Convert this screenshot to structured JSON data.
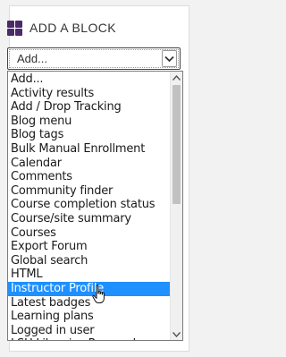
{
  "block": {
    "title": "ADD A BLOCK",
    "select_value": "Add..."
  },
  "icons": {
    "blocks": "blocks-grid-icon",
    "dropdown": "chevron-down-icon",
    "scroll_up": "scroll-up-arrow-icon",
    "scroll_down": "scroll-down-arrow-icon",
    "cursor": "hand-pointer-icon"
  },
  "colors": {
    "icon": "#4a2a6a",
    "selected": "#1e90ff"
  },
  "options": [
    "Add...",
    "Activity results",
    "Add / Drop Tracking",
    "Blog menu",
    "Blog tags",
    "Bulk Manual Enrollment",
    "Calendar",
    "Comments",
    "Community finder",
    "Course completion status",
    "Course/site summary",
    "Courses",
    "Export Forum",
    "Global search",
    "HTML",
    "Instructor Profile",
    "Latest badges",
    "Learning plans",
    "Logged in user",
    "LSU Libraries Research"
  ],
  "highlighted_option": "Instructor Profile"
}
